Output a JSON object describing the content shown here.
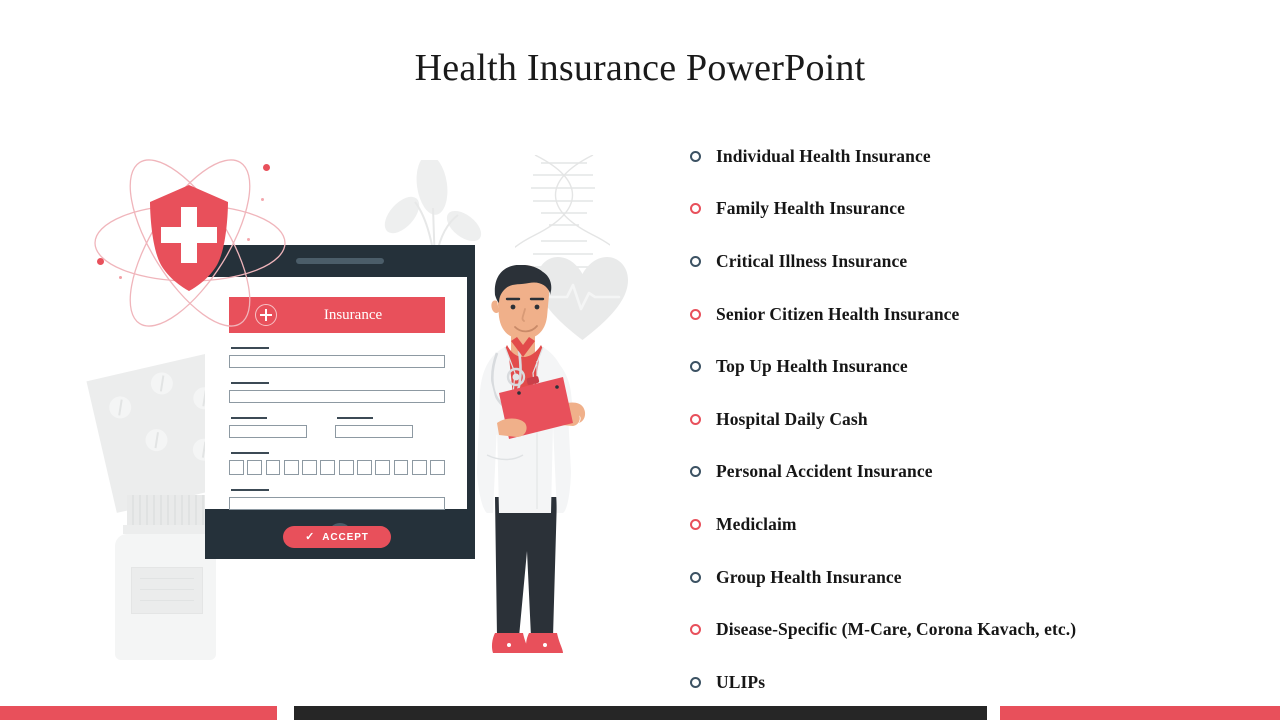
{
  "slide": {
    "title": "Health Insurance PowerPoint",
    "background": "#ffffff"
  },
  "colors": {
    "accent_red": "#e8505b",
    "dark_slate": "#25313a",
    "bullet_dark": "#3c5263",
    "text": "#161616",
    "bar_dark": "#262626"
  },
  "illustration": {
    "name": "health-insurance-illustration",
    "shield_icon": "shield-with-medical-cross",
    "atom_icon": "atom-orbit-rings",
    "dna_icon": "dna-helix",
    "heart_icon": "heart-with-ecg-line",
    "plant_icon": "leaf-plant",
    "pills_icon": "pill-blister-pack",
    "bottle_icon": "medicine-bottle",
    "device_icon": "tablet-device",
    "character_icon": "doctor-character-thumbs-up",
    "form": {
      "header_title": "Insurance",
      "header_icon": "plus-circle-icon",
      "accept_label": "ACCEPT",
      "accept_icon": "check-icon",
      "code_boxes_count": 12
    }
  },
  "list": {
    "items": [
      {
        "label": "Individual Health Insurance",
        "bullet": "dark"
      },
      {
        "label": "Family Health Insurance",
        "bullet": "red"
      },
      {
        "label": "Critical Illness Insurance",
        "bullet": "dark"
      },
      {
        "label": "Senior Citizen Health Insurance",
        "bullet": "red"
      },
      {
        "label": "Top Up Health Insurance",
        "bullet": "dark"
      },
      {
        "label": "Hospital Daily Cash",
        "bullet": "red"
      },
      {
        "label": "Personal Accident Insurance",
        "bullet": "dark"
      },
      {
        "label": "Mediclaim",
        "bullet": "red"
      },
      {
        "label": "Group Health Insurance",
        "bullet": "dark"
      },
      {
        "label": "Disease-Specific (M-Care, Corona Kavach, etc.)",
        "bullet": "red"
      },
      {
        "label": "ULIPs",
        "bullet": "dark"
      }
    ]
  },
  "footer": {
    "bars": [
      {
        "name": "footer-bar-left",
        "color": "#e8505b"
      },
      {
        "name": "footer-bar-middle",
        "color": "#262626"
      },
      {
        "name": "footer-bar-right",
        "color": "#e8505b"
      }
    ]
  }
}
